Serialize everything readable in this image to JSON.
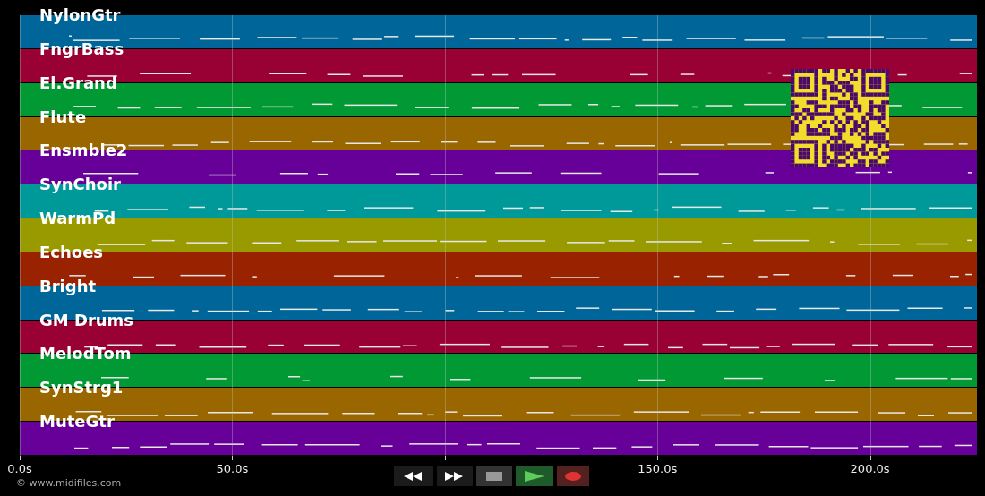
{
  "tracks": [
    {
      "name": "NylonGtr",
      "color": "#006699"
    },
    {
      "name": "FngrBass",
      "color": "#990033"
    },
    {
      "name": "El.Grand",
      "color": "#009933"
    },
    {
      "name": "Flute",
      "color": "#996600"
    },
    {
      "name": "Ensmble2",
      "color": "#660099"
    },
    {
      "name": "SynChoir",
      "color": "#009999"
    },
    {
      "name": "WarmPd",
      "color": "#999900"
    },
    {
      "name": "Echoes",
      "color": "#992200"
    },
    {
      "name": "Bright",
      "color": "#006699"
    },
    {
      "name": "GM Drums",
      "color": "#990033"
    },
    {
      "name": "MelodTom",
      "color": "#009933"
    },
    {
      "name": "SynStrg1",
      "color": "#996600"
    },
    {
      "name": "MuteGtr",
      "color": "#660099"
    }
  ],
  "time_axis": {
    "ticks": [
      {
        "label": "0.0s"
      },
      {
        "label": "50.0s"
      },
      {
        "label": "150.0s"
      },
      {
        "label": "200.0s"
      }
    ]
  },
  "transport": [
    {
      "kind": "rewind"
    },
    {
      "kind": "fast_forward"
    },
    {
      "kind": "stop"
    },
    {
      "kind": "play"
    },
    {
      "kind": "record"
    }
  ],
  "credit": "© www.midifiles.com"
}
